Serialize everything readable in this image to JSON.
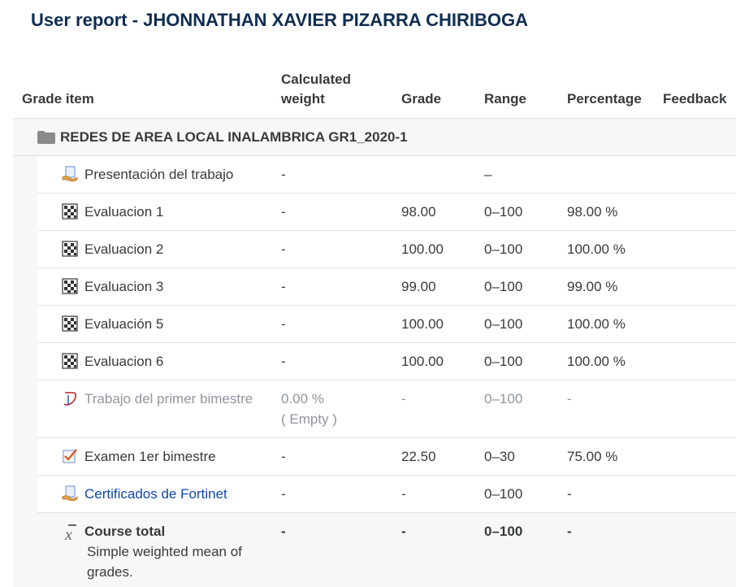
{
  "page": {
    "title": "User report - JHONNATHAN XAVIER PIZARRA CHIRIBOGA"
  },
  "headers": {
    "grade_item": "Grade item",
    "calculated_weight_line1": "Calculated",
    "calculated_weight_line2": "weight",
    "grade": "Grade",
    "range": "Range",
    "percentage": "Percentage",
    "feedback": "Feedback"
  },
  "category": {
    "name": "REDES DE AREA LOCAL INALAMBRICA GR1_2020-1",
    "icon": "folder-icon"
  },
  "items": [
    {
      "name": "Presentación del trabajo",
      "icon": "assignment-icon",
      "weight": "-",
      "grade": "",
      "range": "–",
      "percentage": ""
    },
    {
      "name": "Evaluacion 1",
      "icon": "quiz-icon",
      "weight": "-",
      "grade": "98.00",
      "range": "0–100",
      "percentage": "98.00 %"
    },
    {
      "name": "Evaluacion 2",
      "icon": "quiz-icon",
      "weight": "-",
      "grade": "100.00",
      "range": "0–100",
      "percentage": "100.00 %"
    },
    {
      "name": "Evaluacion 3",
      "icon": "quiz-icon",
      "weight": "-",
      "grade": "99.00",
      "range": "0–100",
      "percentage": "99.00 %"
    },
    {
      "name": "Evaluación 5",
      "icon": "quiz-icon",
      "weight": "-",
      "grade": "100.00",
      "range": "0–100",
      "percentage": "100.00 %"
    },
    {
      "name": "Evaluacion 6",
      "icon": "quiz-icon",
      "weight": "-",
      "grade": "100.00",
      "range": "0–100",
      "percentage": "100.00 %"
    },
    {
      "name": "Trabajo del primer bimestre",
      "icon": "turnitin-icon",
      "weight": "0.00 %",
      "weight_note": "( Empty )",
      "grade": "-",
      "range": "0–100",
      "percentage": "-"
    },
    {
      "name": "Examen 1er bimestre",
      "icon": "checklist-icon",
      "weight": "-",
      "grade": "22.50",
      "range": "0–30",
      "percentage": "75.00 %"
    },
    {
      "name": "Certificados de Fortinet",
      "icon": "assignment-icon",
      "weight": "-",
      "grade": "-",
      "range": "0–100",
      "percentage": "-"
    }
  ],
  "total": {
    "name": "Course total",
    "description": "Simple weighted mean of grades.",
    "icon": "mean-icon",
    "weight": "-",
    "grade": "-",
    "range": "0–100",
    "percentage": "-"
  },
  "colors": {
    "title": "#0f2d52",
    "link": "#0f47ad",
    "muted": "#8f959e",
    "row_border": "#dee2e6",
    "category_bg": "#f7f7f7"
  }
}
